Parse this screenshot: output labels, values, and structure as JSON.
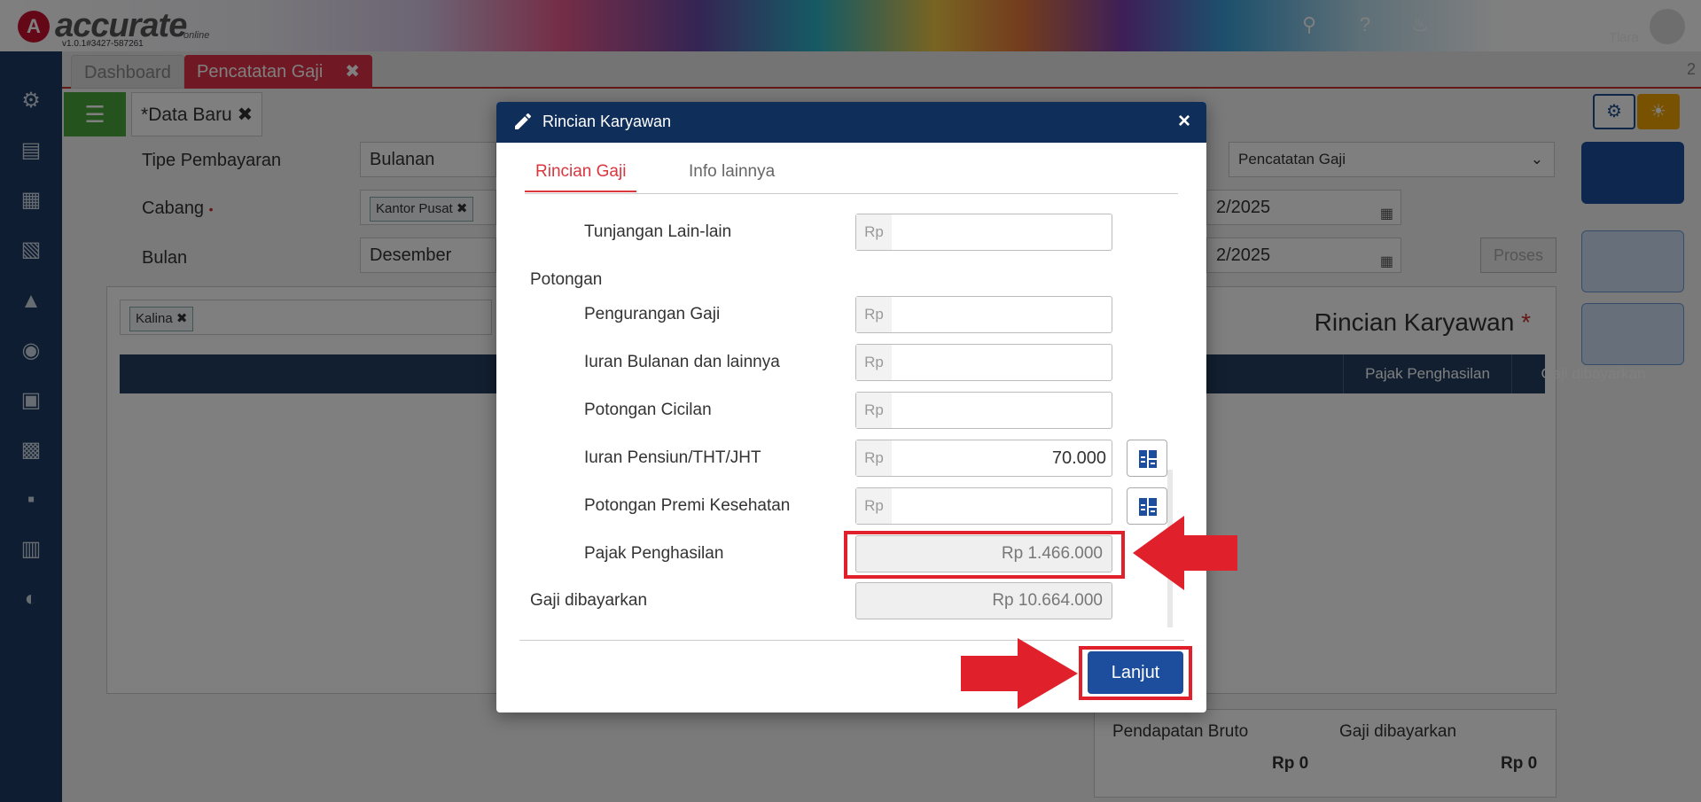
{
  "app": {
    "brand": "accurate",
    "brand_sub": "online",
    "version": "v1.0.1#3427-587261",
    "user_name": "Fifi Fashion",
    "user_sub": "Tlara"
  },
  "tabs": {
    "dashboard": "Dashboard",
    "active": "Pencatatan Gaji",
    "count": "2"
  },
  "subtab": {
    "label": "Data Baru",
    "marker": "*"
  },
  "form": {
    "tipe_label": "Tipe Pembayaran",
    "tipe_value": "Bulanan",
    "cabang_label": "Cabang",
    "cabang_chip": "Kantor Pusat",
    "bulan_label": "Bulan",
    "bulan_value": "Desember",
    "type_select": "Pencatatan Gaji",
    "date1": "2/2025",
    "date2": "2/2025",
    "proses": "Proses",
    "employee_chip": "Kalina"
  },
  "grid": {
    "title": "Rincian Karyawan",
    "col_pajak": "Pajak Penghasilan",
    "col_gaji": "Gaji dibayarkan"
  },
  "summary": {
    "bruto_label": "Pendapatan Bruto",
    "bruto_value": "Rp 0",
    "gaji_label": "Gaji dibayarkan",
    "gaji_value": "Rp 0"
  },
  "modal": {
    "title": "Rincian Karyawan",
    "tab_active": "Rincian Gaji",
    "tab_other": "Info lainnya",
    "rp": "Rp",
    "tunjangan_lain": "Tunjangan Lain-lain",
    "potongan_header": "Potongan",
    "pengurangan_gaji": "Pengurangan Gaji",
    "iuran_bulanan": "Iuran Bulanan dan lainnya",
    "potongan_cicilan": "Potongan Cicilan",
    "iuran_pensiun": "Iuran Pensiun/THT/JHT",
    "iuran_pensiun_value": "70.000",
    "potongan_premi": "Potongan Premi Kesehatan",
    "pajak_label": "Pajak Penghasilan",
    "pajak_value": "Rp 1.466.000",
    "gaji_label": "Gaji dibayarkan",
    "gaji_value": "Rp 10.664.000",
    "lanjut": "Lanjut"
  },
  "colors": {
    "accent_red": "#e0202a",
    "modal_header": "#0f2f5a",
    "primary_button": "#1d4e9e",
    "sidebar": "#1d3a62"
  }
}
